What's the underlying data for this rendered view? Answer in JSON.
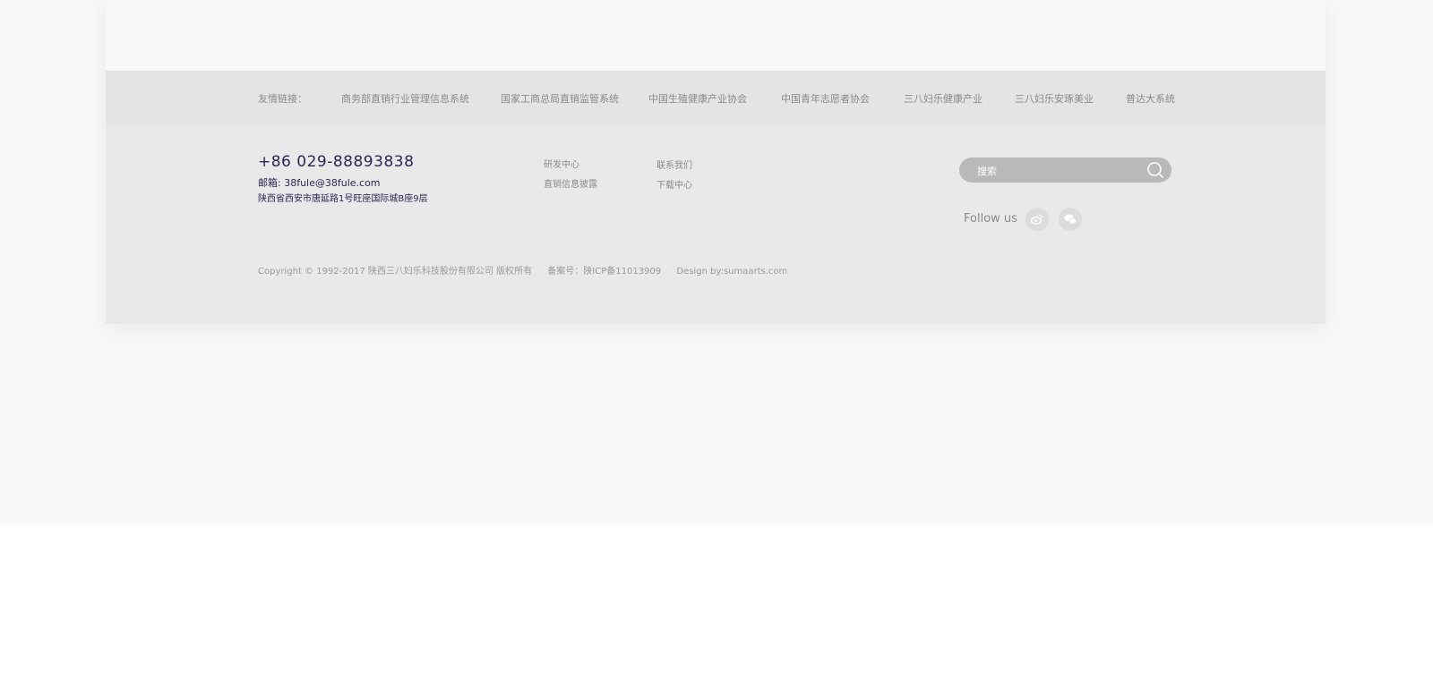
{
  "friend_links": {
    "label": "友情链接：",
    "items": [
      {
        "label": "商务部直销行业管理信息系统"
      },
      {
        "label": "国家工商总局直销监管系统"
      },
      {
        "label": "中国生殖健康产业协会"
      },
      {
        "label": "中国青年志愿者协会"
      },
      {
        "label": "三八妇乐健康产业"
      },
      {
        "label": "三八妇乐安琢美业"
      },
      {
        "label": "普达大系统"
      }
    ]
  },
  "contact": {
    "phone": "+86 029-88893838",
    "email": "邮箱: 38fule@38fule.com",
    "address": "陕西省西安市唐延路1号旺座国际城B座9层"
  },
  "footer_nav": {
    "col1": [
      "研发中心",
      "直销信息披露"
    ],
    "col2": [
      "联系我们",
      "下载中心"
    ]
  },
  "search": {
    "placeholder": "搜索",
    "icon": "search-icon"
  },
  "social": {
    "label": "Follow us",
    "icons": [
      "weibo-icon",
      "wechat-icon"
    ]
  },
  "copyright": {
    "text": "Copyright © 1992-2017 陕西三八妇乐科技股份有限公司 版权所有",
    "icp": "备案号：陕ICP备11013909",
    "design": "Design by:sumaarts.com"
  }
}
